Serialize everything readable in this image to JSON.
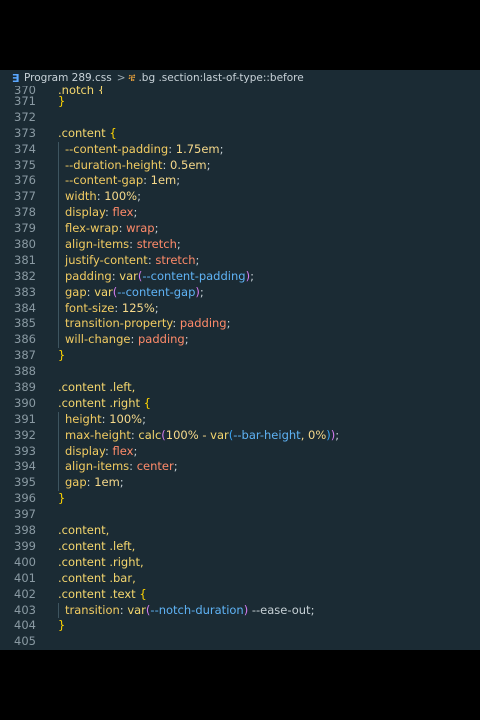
{
  "breadcrumb": {
    "file_icon": "css-file-icon",
    "file": "Program 289.css",
    "separator": ">",
    "symbol_icon": "selector-icon",
    "symbol": ".bg .section:last-of-type::before"
  },
  "colors": {
    "editor_bg": "#1b2b34",
    "line_number": "#8a9aa3",
    "selector": "#f5d76e",
    "property": "#f2cc62",
    "value": "#ff8b6a",
    "variable": "#5fb3f5",
    "bracket": "#ffd500"
  },
  "lines": [
    {
      "n": "370",
      "segs": [
        {
          "t": ".notch {",
          "c": "sel"
        }
      ],
      "cut": true
    },
    {
      "n": "371",
      "segs": [
        {
          "t": "}",
          "c": "br"
        }
      ]
    },
    {
      "n": "372",
      "segs": []
    },
    {
      "n": "373",
      "segs": [
        {
          "t": ".content ",
          "c": "sel"
        },
        {
          "t": "{",
          "c": "br"
        }
      ]
    },
    {
      "n": "374",
      "ind": true,
      "segs": [
        {
          "t": "--content-padding",
          "c": "prop"
        },
        {
          "t": ": ",
          "c": "p"
        },
        {
          "t": "1.75em",
          "c": "num"
        },
        {
          "t": ";",
          "c": "p"
        }
      ]
    },
    {
      "n": "375",
      "ind": true,
      "segs": [
        {
          "t": "--duration-height",
          "c": "prop"
        },
        {
          "t": ": ",
          "c": "p"
        },
        {
          "t": "0.5em",
          "c": "num"
        },
        {
          "t": ";",
          "c": "p"
        }
      ]
    },
    {
      "n": "376",
      "ind": true,
      "segs": [
        {
          "t": "--content-gap",
          "c": "prop"
        },
        {
          "t": ": ",
          "c": "p"
        },
        {
          "t": "1em",
          "c": "num"
        },
        {
          "t": ";",
          "c": "p"
        }
      ]
    },
    {
      "n": "377",
      "ind": true,
      "segs": [
        {
          "t": "width",
          "c": "prop"
        },
        {
          "t": ": ",
          "c": "p"
        },
        {
          "t": "100%",
          "c": "num"
        },
        {
          "t": ";",
          "c": "p"
        }
      ]
    },
    {
      "n": "378",
      "ind": true,
      "segs": [
        {
          "t": "display",
          "c": "prop"
        },
        {
          "t": ": ",
          "c": "p"
        },
        {
          "t": "flex",
          "c": "val"
        },
        {
          "t": ";",
          "c": "p"
        }
      ]
    },
    {
      "n": "379",
      "ind": true,
      "segs": [
        {
          "t": "flex-wrap",
          "c": "prop"
        },
        {
          "t": ": ",
          "c": "p"
        },
        {
          "t": "wrap",
          "c": "val"
        },
        {
          "t": ";",
          "c": "p"
        }
      ]
    },
    {
      "n": "380",
      "ind": true,
      "segs": [
        {
          "t": "align-items",
          "c": "prop"
        },
        {
          "t": ": ",
          "c": "p"
        },
        {
          "t": "stretch",
          "c": "val"
        },
        {
          "t": ";",
          "c": "p"
        }
      ]
    },
    {
      "n": "381",
      "ind": true,
      "segs": [
        {
          "t": "justify-content",
          "c": "prop"
        },
        {
          "t": ": ",
          "c": "p"
        },
        {
          "t": "stretch",
          "c": "val"
        },
        {
          "t": ";",
          "c": "p"
        }
      ]
    },
    {
      "n": "382",
      "ind": true,
      "segs": [
        {
          "t": "padding",
          "c": "prop"
        },
        {
          "t": ": ",
          "c": "p"
        },
        {
          "t": "var",
          "c": "fn"
        },
        {
          "t": "(",
          "c": "br2"
        },
        {
          "t": "--content-padding",
          "c": "var"
        },
        {
          "t": ")",
          "c": "br2"
        },
        {
          "t": ";",
          "c": "p"
        }
      ]
    },
    {
      "n": "383",
      "ind": true,
      "segs": [
        {
          "t": "gap",
          "c": "prop"
        },
        {
          "t": ": ",
          "c": "p"
        },
        {
          "t": "var",
          "c": "fn"
        },
        {
          "t": "(",
          "c": "br2"
        },
        {
          "t": "--content-gap",
          "c": "var"
        },
        {
          "t": ")",
          "c": "br2"
        },
        {
          "t": ";",
          "c": "p"
        }
      ]
    },
    {
      "n": "384",
      "ind": true,
      "segs": [
        {
          "t": "font-size",
          "c": "prop"
        },
        {
          "t": ": ",
          "c": "p"
        },
        {
          "t": "125%",
          "c": "num"
        },
        {
          "t": ";",
          "c": "p"
        }
      ]
    },
    {
      "n": "385",
      "ind": true,
      "segs": [
        {
          "t": "transition-property",
          "c": "prop"
        },
        {
          "t": ": ",
          "c": "p"
        },
        {
          "t": "padding",
          "c": "val"
        },
        {
          "t": ";",
          "c": "p"
        }
      ]
    },
    {
      "n": "386",
      "ind": true,
      "segs": [
        {
          "t": "will-change",
          "c": "prop"
        },
        {
          "t": ": ",
          "c": "p"
        },
        {
          "t": "padding",
          "c": "val"
        },
        {
          "t": ";",
          "c": "p"
        }
      ]
    },
    {
      "n": "387",
      "segs": [
        {
          "t": "}",
          "c": "br"
        }
      ]
    },
    {
      "n": "388",
      "segs": []
    },
    {
      "n": "389",
      "segs": [
        {
          "t": ".content .left,",
          "c": "sel"
        }
      ]
    },
    {
      "n": "390",
      "segs": [
        {
          "t": ".content .right ",
          "c": "sel"
        },
        {
          "t": "{",
          "c": "br"
        }
      ]
    },
    {
      "n": "391",
      "ind": true,
      "segs": [
        {
          "t": "height",
          "c": "prop"
        },
        {
          "t": ": ",
          "c": "p"
        },
        {
          "t": "100%",
          "c": "num"
        },
        {
          "t": ";",
          "c": "p"
        }
      ]
    },
    {
      "n": "392",
      "ind": true,
      "segs": [
        {
          "t": "max-height",
          "c": "prop"
        },
        {
          "t": ": ",
          "c": "p"
        },
        {
          "t": "calc",
          "c": "fn"
        },
        {
          "t": "(",
          "c": "br2"
        },
        {
          "t": "100% - ",
          "c": "num"
        },
        {
          "t": "var",
          "c": "fn"
        },
        {
          "t": "(",
          "c": "br3"
        },
        {
          "t": "--bar-height",
          "c": "var"
        },
        {
          "t": ", 0%",
          "c": "num"
        },
        {
          "t": ")",
          "c": "br3"
        },
        {
          "t": ")",
          "c": "br2"
        },
        {
          "t": ";",
          "c": "p"
        }
      ]
    },
    {
      "n": "393",
      "ind": true,
      "segs": [
        {
          "t": "display",
          "c": "prop"
        },
        {
          "t": ": ",
          "c": "p"
        },
        {
          "t": "flex",
          "c": "val"
        },
        {
          "t": ";",
          "c": "p"
        }
      ]
    },
    {
      "n": "394",
      "ind": true,
      "segs": [
        {
          "t": "align-items",
          "c": "prop"
        },
        {
          "t": ": ",
          "c": "p"
        },
        {
          "t": "center",
          "c": "val"
        },
        {
          "t": ";",
          "c": "p"
        }
      ]
    },
    {
      "n": "395",
      "ind": true,
      "segs": [
        {
          "t": "gap",
          "c": "prop"
        },
        {
          "t": ": ",
          "c": "p"
        },
        {
          "t": "1em",
          "c": "num"
        },
        {
          "t": ";",
          "c": "p"
        }
      ]
    },
    {
      "n": "396",
      "segs": [
        {
          "t": "}",
          "c": "br"
        }
      ]
    },
    {
      "n": "397",
      "segs": []
    },
    {
      "n": "398",
      "segs": [
        {
          "t": ".content,",
          "c": "sel"
        }
      ]
    },
    {
      "n": "399",
      "segs": [
        {
          "t": ".content .left,",
          "c": "sel"
        }
      ]
    },
    {
      "n": "400",
      "segs": [
        {
          "t": ".content .right,",
          "c": "sel"
        }
      ]
    },
    {
      "n": "401",
      "segs": [
        {
          "t": ".content .bar,",
          "c": "sel"
        }
      ]
    },
    {
      "n": "402",
      "segs": [
        {
          "t": ".content .text ",
          "c": "sel"
        },
        {
          "t": "{",
          "c": "br"
        }
      ]
    },
    {
      "n": "403",
      "ind": true,
      "segs": [
        {
          "t": "transition",
          "c": "prop"
        },
        {
          "t": ": ",
          "c": "p"
        },
        {
          "t": "var",
          "c": "fn"
        },
        {
          "t": "(",
          "c": "br2"
        },
        {
          "t": "--notch-duration",
          "c": "var"
        },
        {
          "t": ")",
          "c": "br2"
        },
        {
          "t": " --ease-out",
          "c": "p"
        },
        {
          "t": ";",
          "c": "p"
        }
      ]
    },
    {
      "n": "404",
      "segs": [
        {
          "t": "}",
          "c": "br"
        }
      ]
    },
    {
      "n": "405",
      "segs": []
    }
  ]
}
